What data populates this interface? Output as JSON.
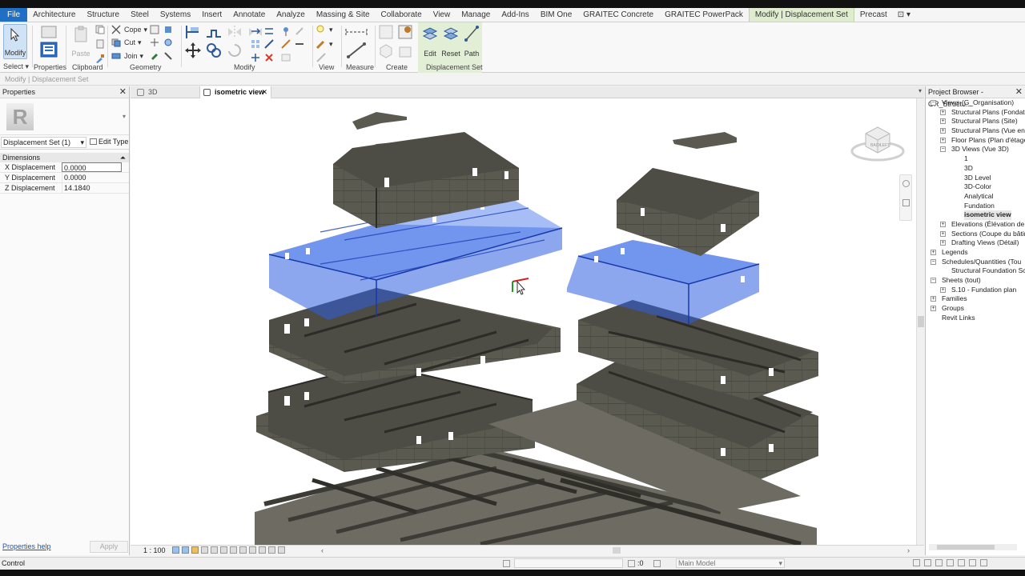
{
  "ribbon_tabs": [
    "File",
    "Architecture",
    "Structure",
    "Steel",
    "Systems",
    "Insert",
    "Annotate",
    "Analyze",
    "Massing & Site",
    "Collaborate",
    "View",
    "Manage",
    "Add-Ins",
    "BIM One",
    "GRAITEC Concrete",
    "GRAITEC PowerPack",
    "Modify | Displacement Set",
    "Precast"
  ],
  "active_tab_index": 16,
  "ribbon": {
    "modify_label": "Modify",
    "paste_label": "Paste",
    "cope_label": "Cope",
    "cut_label": "Cut",
    "join_label": "Join",
    "edit_label": "Edit",
    "reset_label": "Reset",
    "path_label": "Path",
    "groups": {
      "select": "Select",
      "properties": "Properties",
      "clipboard": "Clipboard",
      "geometry": "Geometry",
      "modify": "Modify",
      "view": "View",
      "measure": "Measure",
      "create": "Create",
      "displacement_set": "Displacement Set"
    }
  },
  "options_bar": "Modify | Displacement Set",
  "properties": {
    "title": "Properties",
    "type_selector": "Displacement Set (1)",
    "edit_type": "Edit Type",
    "category": "Dimensions",
    "rows": [
      {
        "name": "X Displacement",
        "value": "0.0000"
      },
      {
        "name": "Y Displacement",
        "value": "0.0000"
      },
      {
        "name": "Z Displacement",
        "value": "14.1840"
      }
    ],
    "help_link": "Properties help",
    "apply": "Apply"
  },
  "view_tabs": [
    {
      "label": "3D",
      "active": false
    },
    {
      "label": "isometric view",
      "active": true
    }
  ],
  "view_status": {
    "scale": "1 : 100"
  },
  "project_browser": {
    "title": "Project Browser - GR_Structu...",
    "items": [
      {
        "label": "Views (G_Organisation)",
        "level": 0,
        "toggle": "−"
      },
      {
        "label": "Structural Plans (Fondatio",
        "level": 1,
        "toggle": "+"
      },
      {
        "label": "Structural Plans (Site)",
        "level": 1,
        "toggle": "+"
      },
      {
        "label": "Structural Plans (Vue en p",
        "level": 1,
        "toggle": "+"
      },
      {
        "label": "Floor Plans (Plan d'étage",
        "level": 1,
        "toggle": "+"
      },
      {
        "label": "3D Views (Vue 3D)",
        "level": 1,
        "toggle": "−"
      },
      {
        "label": "1",
        "level": 2,
        "toggle": ""
      },
      {
        "label": "3D",
        "level": 2,
        "toggle": ""
      },
      {
        "label": "3D Level",
        "level": 2,
        "toggle": ""
      },
      {
        "label": "3D-Color",
        "level": 2,
        "toggle": ""
      },
      {
        "label": "Analytical",
        "level": 2,
        "toggle": ""
      },
      {
        "label": "Fundation",
        "level": 2,
        "toggle": ""
      },
      {
        "label": "isometric view",
        "level": 2,
        "toggle": "",
        "selected": true
      },
      {
        "label": "Elevations (Élévation de c",
        "level": 1,
        "toggle": "+"
      },
      {
        "label": "Sections (Coupe du bâtim",
        "level": 1,
        "toggle": "+"
      },
      {
        "label": "Drafting Views (Détail)",
        "level": 1,
        "toggle": "+"
      },
      {
        "label": "Legends",
        "level": 0,
        "toggle": "+"
      },
      {
        "label": "Schedules/Quantities (Tou",
        "level": 0,
        "toggle": "−"
      },
      {
        "label": "Structural Foundation Sch",
        "level": 1,
        "toggle": ""
      },
      {
        "label": "Sheets (tout)",
        "level": 0,
        "toggle": "−"
      },
      {
        "label": "S.10 - Fundation plan",
        "level": 1,
        "toggle": "+"
      },
      {
        "label": "Families",
        "level": 0,
        "toggle": "+"
      },
      {
        "label": "Groups",
        "level": 0,
        "toggle": "+"
      },
      {
        "label": "Revit Links",
        "level": 0,
        "toggle": ""
      }
    ]
  },
  "status_bar": {
    "left": "Control",
    "zero": ":0",
    "model": "Main Model"
  },
  "colors": {
    "file_tab": "#1f6fc5",
    "contextual_tab": "#dfeccf",
    "selection_blue": "#2f5fe0",
    "concrete": "#5b5a50"
  }
}
